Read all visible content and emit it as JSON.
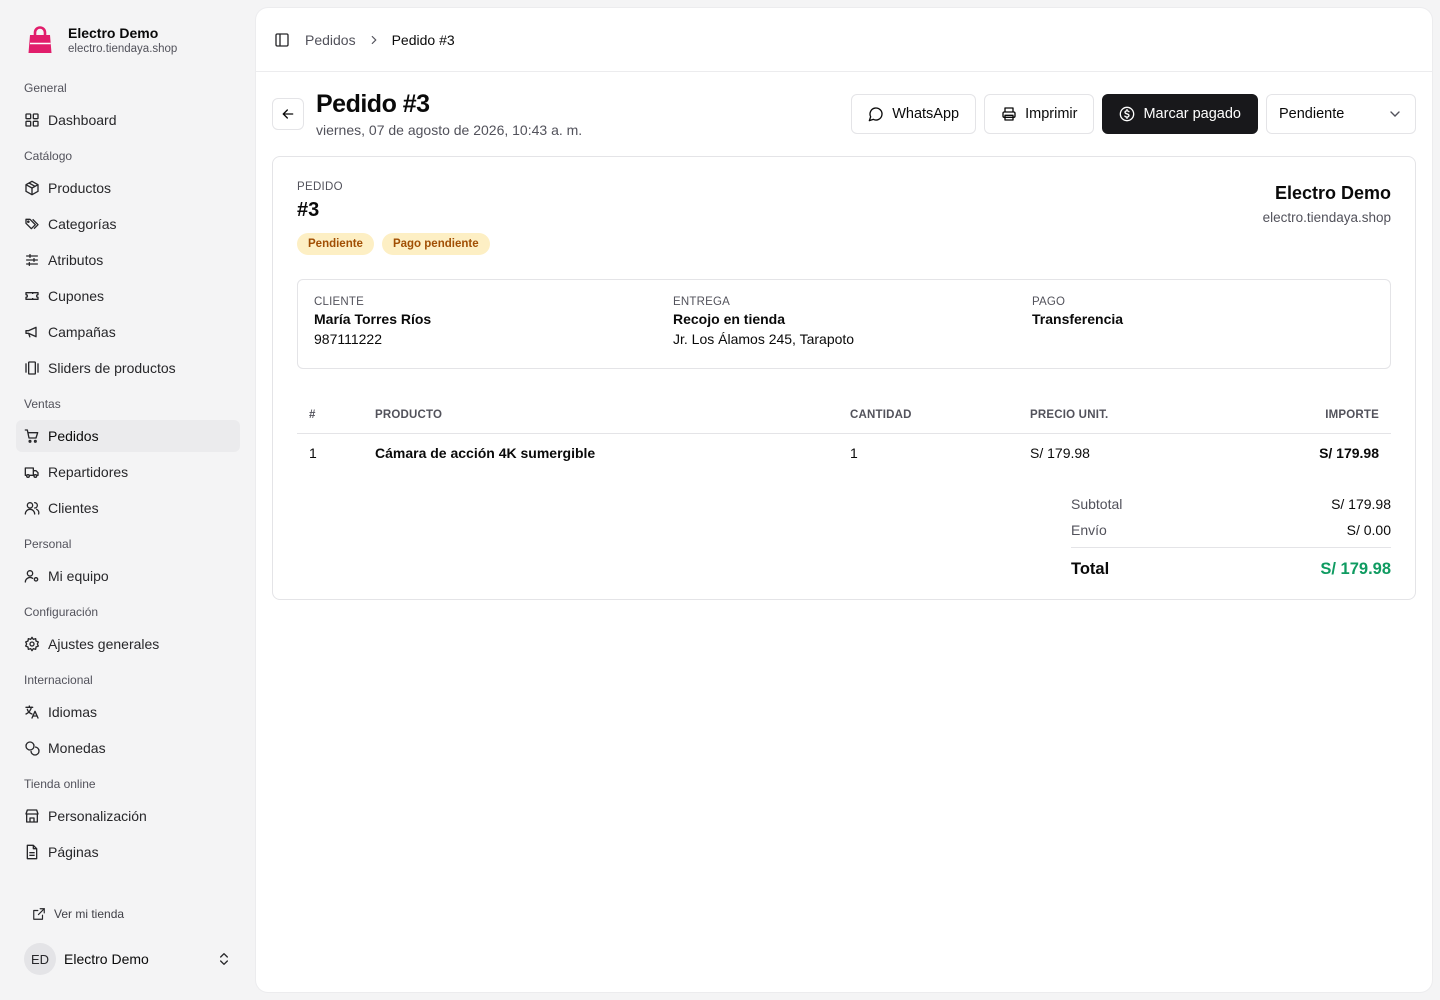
{
  "brand": {
    "name": "Electro Demo",
    "domain": "electro.tiendaya.shop",
    "logo_icon": "shopping-bag-icon",
    "logo_color": "#e11d6b"
  },
  "nav": {
    "groups": [
      {
        "label": "General",
        "items": [
          {
            "label": "Dashboard",
            "icon": "layout-grid-icon"
          }
        ]
      },
      {
        "label": "Catálogo",
        "items": [
          {
            "label": "Productos",
            "icon": "box-icon"
          },
          {
            "label": "Categorías",
            "icon": "tags-icon"
          },
          {
            "label": "Atributos",
            "icon": "sliders-icon"
          },
          {
            "label": "Cupones",
            "icon": "ticket-icon"
          },
          {
            "label": "Campañas",
            "icon": "megaphone-icon"
          },
          {
            "label": "Sliders de productos",
            "icon": "gallery-icon"
          }
        ]
      },
      {
        "label": "Ventas",
        "items": [
          {
            "label": "Pedidos",
            "icon": "cart-icon",
            "active": true
          },
          {
            "label": "Repartidores",
            "icon": "truck-icon"
          },
          {
            "label": "Clientes",
            "icon": "users-icon"
          }
        ]
      },
      {
        "label": "Personal",
        "items": [
          {
            "label": "Mi equipo",
            "icon": "user-cog-icon"
          }
        ]
      },
      {
        "label": "Configuración",
        "items": [
          {
            "label": "Ajustes generales",
            "icon": "gear-icon"
          }
        ]
      },
      {
        "label": "Internacional",
        "items": [
          {
            "label": "Idiomas",
            "icon": "languages-icon"
          },
          {
            "label": "Monedas",
            "icon": "coins-icon"
          }
        ]
      },
      {
        "label": "Tienda online",
        "items": [
          {
            "label": "Personalización",
            "icon": "store-icon"
          },
          {
            "label": "Páginas",
            "icon": "file-text-icon"
          }
        ]
      }
    ],
    "visit_store": "Ver mi tienda"
  },
  "account": {
    "initials": "ED",
    "name": "Electro Demo"
  },
  "breadcrumb": {
    "parent": "Pedidos",
    "current": "Pedido #3"
  },
  "header": {
    "title": "Pedido #3",
    "date": "viernes, 07 de agosto de 2026, 10:43 a. m."
  },
  "actions": {
    "whatsapp": "WhatsApp",
    "print": "Imprimir",
    "mark_paid": "Marcar pagado",
    "status_select": "Pendiente"
  },
  "order": {
    "label": "PEDIDO",
    "number": "#3",
    "badges": [
      {
        "label": "Pendiente",
        "bg": "#fdefc4",
        "color": "#a14f04"
      },
      {
        "label": "Pago pendiente",
        "bg": "#fdefc4",
        "color": "#a14f04"
      }
    ],
    "store_name": "Electro Demo",
    "store_domain": "electro.tiendaya.shop"
  },
  "info": {
    "customer": {
      "label": "CLIENTE",
      "name": "María Torres Ríos",
      "phone": "987111222"
    },
    "delivery": {
      "label": "ENTREGA",
      "method": "Recojo en tienda",
      "address": "Jr. Los Álamos 245, Tarapoto"
    },
    "payment": {
      "label": "PAGO",
      "method": "Transferencia"
    }
  },
  "table": {
    "headers": [
      "#",
      "PRODUCTO",
      "CANTIDAD",
      "PRECIO UNIT.",
      "IMPORTE"
    ],
    "rows": [
      {
        "num": "1",
        "product": "Cámara de acción 4K sumergible",
        "qty": "1",
        "price": "S/ 179.98",
        "amount": "S/ 179.98"
      }
    ]
  },
  "totals": {
    "subtotal_label": "Subtotal",
    "subtotal": "S/ 179.98",
    "shipping_label": "Envío",
    "shipping": "S/ 0.00",
    "total_label": "Total",
    "total": "S/ 179.98",
    "total_color": "#0f9b61"
  }
}
